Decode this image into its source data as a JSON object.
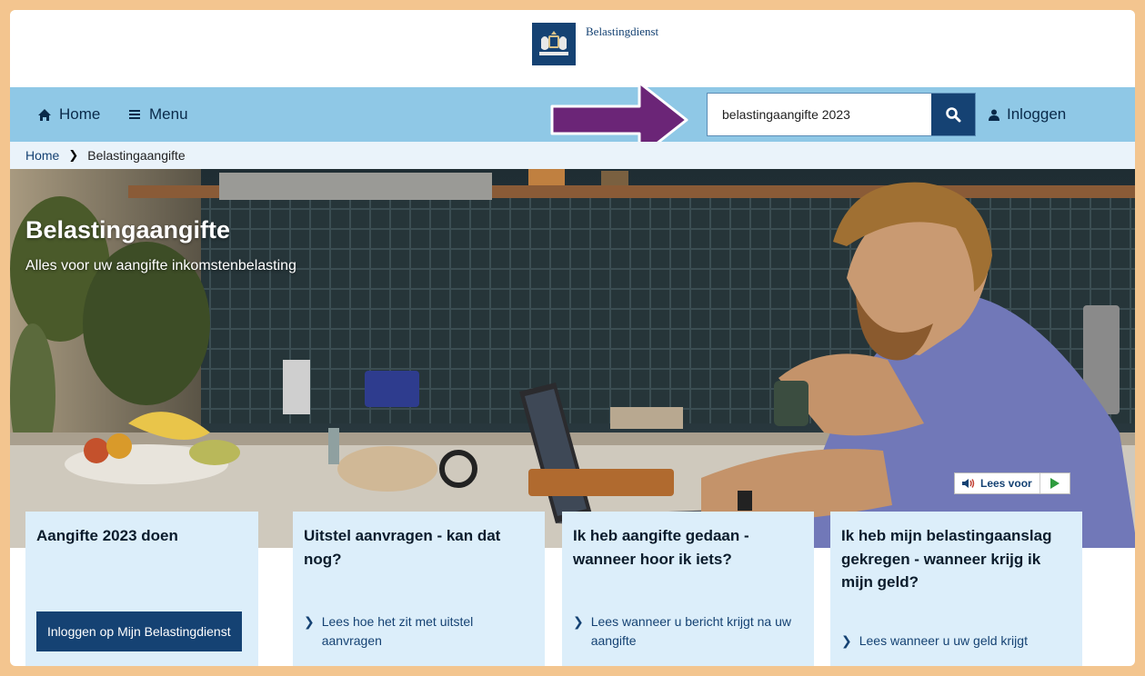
{
  "header": {
    "logo_text": "Belastingdienst"
  },
  "nav": {
    "home_label": "Home",
    "menu_label": "Menu",
    "search_value": "belastingaangifte 2023",
    "login_label": "Inloggen"
  },
  "breadcrumb": {
    "home": "Home",
    "current": "Belastingaangifte"
  },
  "hero": {
    "title": "Belastingaangifte",
    "subtitle": "Alles voor uw aangifte inkomstenbelasting",
    "lees_voor": "Lees voor"
  },
  "cards": [
    {
      "title": "Aangifte 2023 doen",
      "button": "Inloggen op Mijn Belastingdienst"
    },
    {
      "title": "Uitstel aanvragen - kan dat nog?",
      "link": "Lees hoe het zit met uitstel aanvragen"
    },
    {
      "title": "Ik heb aangifte gedaan - wanneer hoor ik iets?",
      "link": "Lees wanneer u bericht krijgt na uw aangifte"
    },
    {
      "title": "Ik heb mijn belastingaanslag gekregen - wanneer krijg ik mijn geld?",
      "link": "Lees wanneer u uw geld krijgt"
    }
  ],
  "colors": {
    "page_border": "#f3c58f",
    "nav_bg": "#8fc8e6",
    "brand_blue": "#154273",
    "card_bg": "#dceefa",
    "arrow_purple": "#6b2577"
  },
  "icons": [
    "coat-of-arms-logo",
    "home-icon",
    "menu-icon",
    "search-icon",
    "user-icon",
    "speaker-icon",
    "play-icon",
    "chevron-right-icon"
  ]
}
